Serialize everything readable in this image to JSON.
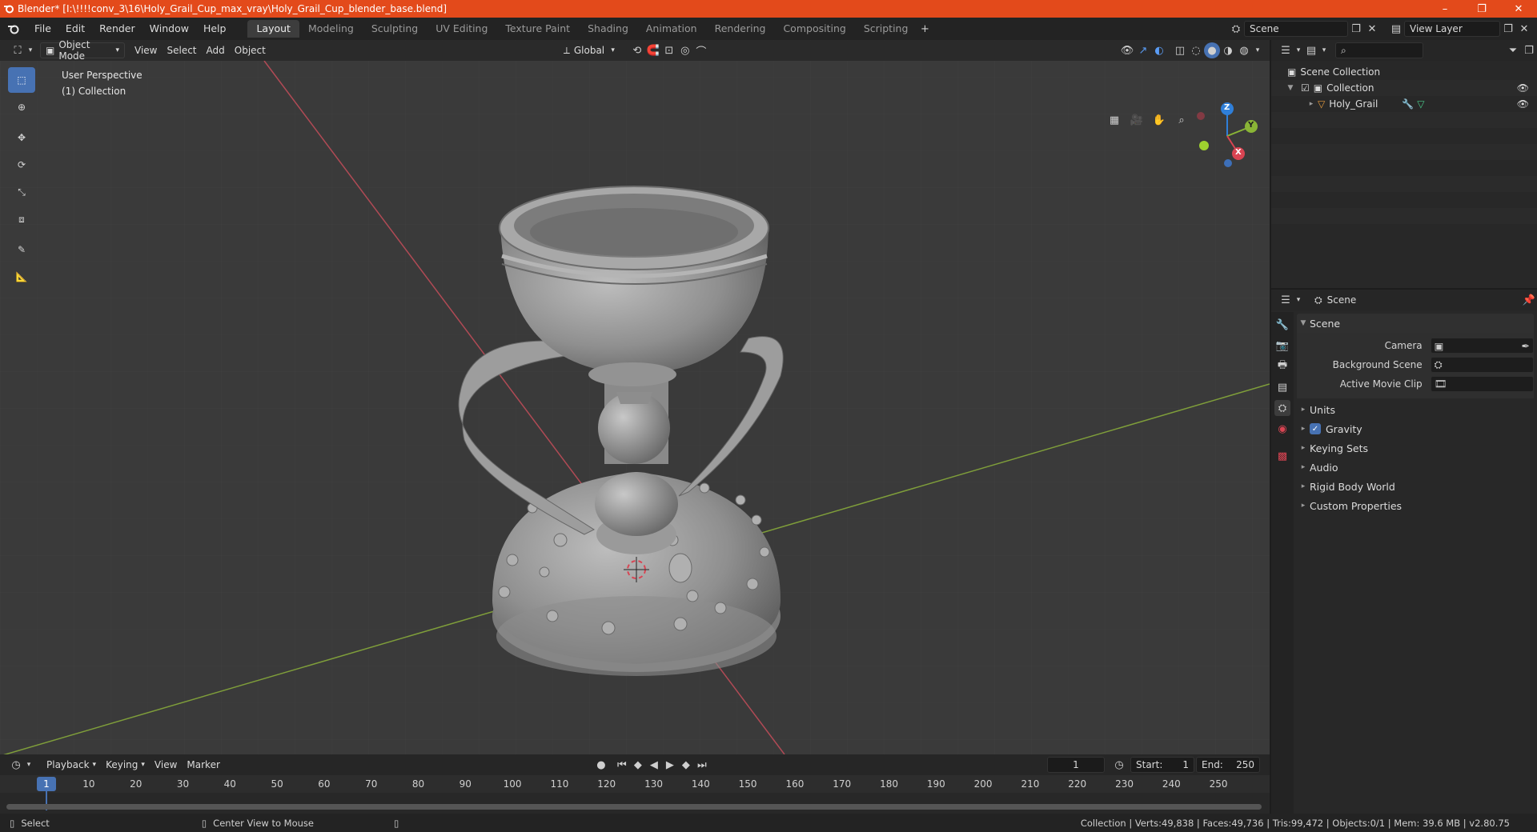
{
  "window": {
    "title": "Blender* [I:\\!!!!conv_3\\16\\Holy_Grail_Cup_max_vray\\Holy_Grail_Cup_blender_base.blend]",
    "controls": [
      "–",
      "❐",
      "✕"
    ]
  },
  "menu": [
    "File",
    "Edit",
    "Render",
    "Window",
    "Help"
  ],
  "workspaces": [
    "Layout",
    "Modeling",
    "Sculpting",
    "UV Editing",
    "Texture Paint",
    "Shading",
    "Animation",
    "Rendering",
    "Compositing",
    "Scripting"
  ],
  "active_workspace": "Layout",
  "scene_field": "Scene",
  "view_layer_field": "View Layer",
  "viewport": {
    "mode": "Object Mode",
    "menus": [
      "View",
      "Select",
      "Add",
      "Object"
    ],
    "transform_orientation": "Global",
    "info_line1": "User Perspective",
    "info_line2": "(1) Collection",
    "gizmo": {
      "z": "Z",
      "y": "Y",
      "x": "X"
    }
  },
  "outliner": {
    "root": "Scene Collection",
    "collection": "Collection",
    "object": "Holy_Grail"
  },
  "properties": {
    "context": "Scene",
    "panel_title": "Scene",
    "fields": [
      {
        "label": "Camera",
        "value": ""
      },
      {
        "label": "Background Scene",
        "value": ""
      },
      {
        "label": "Active Movie Clip",
        "value": ""
      }
    ],
    "sections": [
      "Units",
      "Gravity",
      "Keying Sets",
      "Audio",
      "Rigid Body World",
      "Custom Properties"
    ],
    "gravity_enabled": true
  },
  "timeline": {
    "menus": [
      "Playback",
      "Keying",
      "View",
      "Marker"
    ],
    "current_frame": "1",
    "start_label": "Start:",
    "start": "1",
    "end_label": "End:",
    "end": "250",
    "ticks": [
      "1",
      "10",
      "20",
      "30",
      "40",
      "50",
      "60",
      "70",
      "80",
      "90",
      "100",
      "110",
      "120",
      "130",
      "140",
      "150",
      "160",
      "170",
      "180",
      "190",
      "200",
      "210",
      "220",
      "230",
      "240",
      "250"
    ]
  },
  "status": {
    "left_action": "Select",
    "middle_action": "Center View to Mouse",
    "stats": "Collection | Verts:49,838 | Faces:49,736 | Tris:99,472 | Objects:0/1 | Mem: 39.6 MB | v2.80.75"
  },
  "colors": {
    "accent": "#e34a1b",
    "selection": "#4772b3",
    "axis_x": "#d94452",
    "axis_y": "#8ab536",
    "axis_z": "#2f7fd9"
  }
}
